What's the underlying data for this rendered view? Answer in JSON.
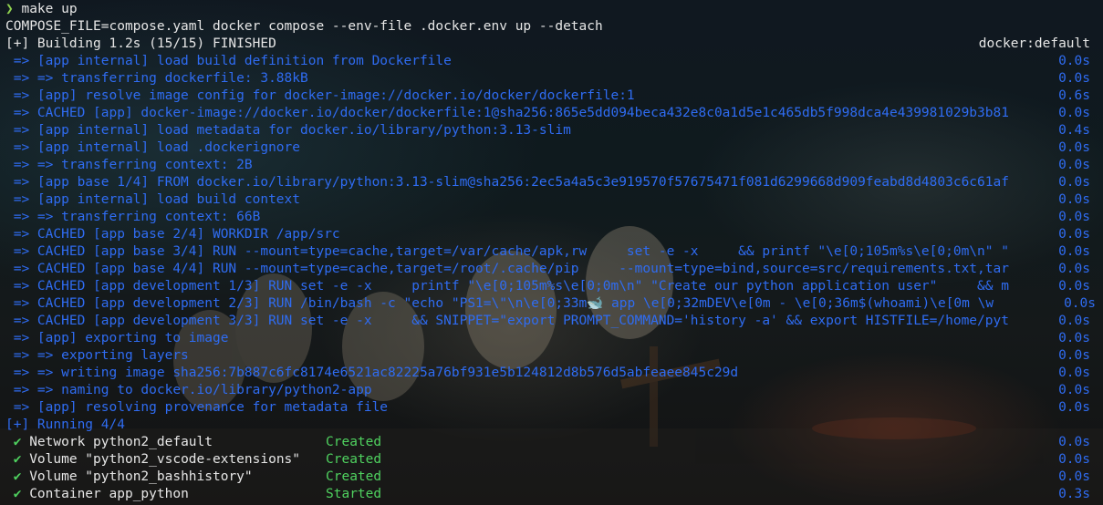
{
  "prompt": {
    "arrow": "❯",
    "command": "make up"
  },
  "echo_command": "COMPOSE_FILE=compose.yaml docker compose --env-file .docker.env up --detach",
  "build_header": {
    "text": "[+] Building 1.2s (15/15) FINISHED",
    "context": "docker:default"
  },
  "build_steps": [
    {
      "text": " => [app internal] load build definition from Dockerfile",
      "time": "0.0s"
    },
    {
      "text": " => => transferring dockerfile: 3.88kB",
      "time": "0.0s"
    },
    {
      "text": " => [app] resolve image config for docker-image://docker.io/docker/dockerfile:1",
      "time": "0.6s"
    },
    {
      "text": " => CACHED [app] docker-image://docker.io/docker/dockerfile:1@sha256:865e5dd094beca432e8c0a1d5e1c465db5f998dca4e439981029b3b81",
      "time": "0.0s"
    },
    {
      "text": " => [app internal] load metadata for docker.io/library/python:3.13-slim",
      "time": "0.4s"
    },
    {
      "text": " => [app internal] load .dockerignore",
      "time": "0.0s"
    },
    {
      "text": " => => transferring context: 2B",
      "time": "0.0s"
    },
    {
      "text": " => [app base 1/4] FROM docker.io/library/python:3.13-slim@sha256:2ec5a4a5c3e919570f57675471f081d6299668d909feabd8d4803c6c61af",
      "time": "0.0s"
    },
    {
      "text": " => [app internal] load build context",
      "time": "0.0s"
    },
    {
      "text": " => => transferring context: 66B",
      "time": "0.0s"
    },
    {
      "text": " => CACHED [app base 2/4] WORKDIR /app/src",
      "time": "0.0s"
    },
    {
      "text": " => CACHED [app base 3/4] RUN --mount=type=cache,target=/var/cache/apk,rw     set -e -x     && printf \"\\e[0;105m%s\\e[0;0m\\n\" \"",
      "time": "0.0s"
    },
    {
      "text": " => CACHED [app base 4/4] RUN --mount=type=cache,target=/root/.cache/pip     --mount=type=bind,source=src/requirements.txt,tar",
      "time": "0.0s"
    },
    {
      "text": " => CACHED [app development 1/3] RUN set -e -x     printf \"\\e[0;105m%s\\e[0;0m\\n\" \"Create our python application user\"     && m",
      "time": "0.0s"
    },
    {
      "text": " => CACHED [app development 2/3] RUN /bin/bash -c \"echo \"PS1=\\\"\\n\\e[0;33m🐋 app \\e[0;32mDEV\\e[0m - \\e[0;36m$(whoami)\\e[0m \\w",
      "time": "0.0s",
      "offset": true
    },
    {
      "text": " => CACHED [app development 3/3] RUN set -e -x     && SNIPPET=\"export PROMPT_COMMAND='history -a' && export HISTFILE=/home/pyt",
      "time": "0.0s"
    },
    {
      "text": " => [app] exporting to image",
      "time": "0.0s"
    },
    {
      "text": " => => exporting layers",
      "time": "0.0s"
    },
    {
      "text": " => => writing image sha256:7b887c6fc8174e6521ac82225a76bf931e5b124812d8b576d5abfeaee845c29d",
      "time": "0.0s"
    },
    {
      "text": " => => naming to docker.io/library/python2-app",
      "time": "0.0s"
    },
    {
      "text": " => [app] resolving provenance for metadata file",
      "time": "0.0s"
    }
  ],
  "running_header": "[+] Running 4/4",
  "resources": [
    {
      "check": "✔",
      "name": "Network python2_default",
      "status": "Created",
      "time": "0.0s"
    },
    {
      "check": "✔",
      "name": "Volume \"python2_vscode-extensions\"",
      "status": "Created",
      "time": "0.0s"
    },
    {
      "check": "✔",
      "name": "Volume \"python2_bashhistory\"",
      "status": "Created",
      "time": "0.0s"
    },
    {
      "check": "✔",
      "name": "Container app_python",
      "status": "Started",
      "time": "0.3s"
    }
  ],
  "colors": {
    "prompt_arrow": "#8fd14f",
    "build_step": "#2f6cf2",
    "success": "#4fd15f",
    "text": "#e6e6e6"
  }
}
